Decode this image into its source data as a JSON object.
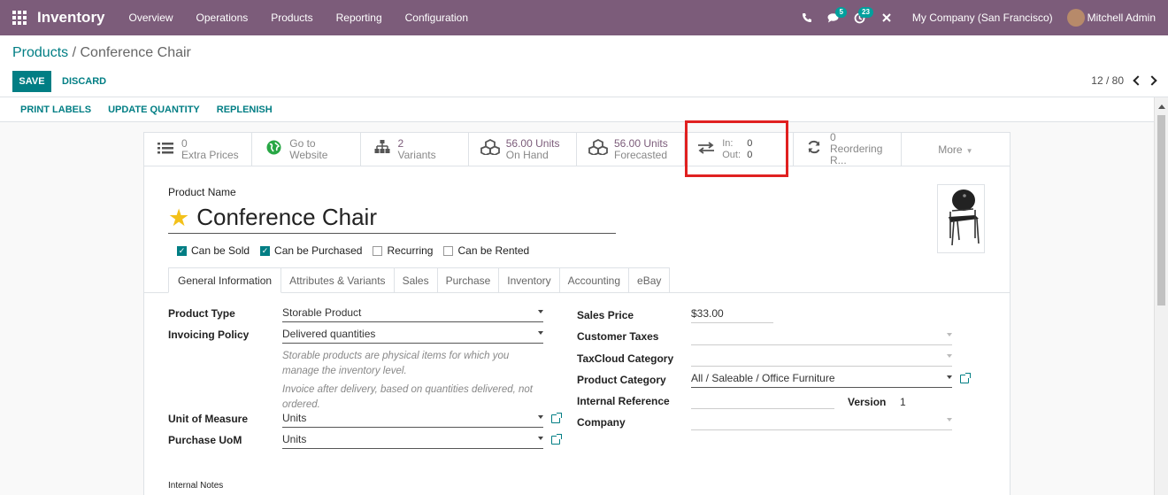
{
  "navbar": {
    "app_title": "Inventory",
    "menu": [
      "Overview",
      "Operations",
      "Products",
      "Reporting",
      "Configuration"
    ],
    "icons": [
      "phone-icon",
      "chat-icon",
      "activity-icon",
      "debug-icon"
    ],
    "chat_badge": "5",
    "activity_badge": "23",
    "company": "My Company (San Francisco)",
    "user": "Mitchell Admin",
    "color": "#7c5c7a"
  },
  "breadcrumb": {
    "parent": "Products",
    "separator": " / ",
    "current": "Conference Chair"
  },
  "buttons": {
    "save": "SAVE",
    "discard": "DISCARD"
  },
  "pager": {
    "value": "12 / 80"
  },
  "actions": [
    "PRINT LABELS",
    "UPDATE QUANTITY",
    "REPLENISH"
  ],
  "smart_buttons": {
    "extra_prices": {
      "value": "0",
      "label": "Extra Prices",
      "icon": "list-icon"
    },
    "website": {
      "value": "Go to",
      "label": "Website",
      "icon": "globe-icon"
    },
    "variants": {
      "value": "2",
      "label": "Variants",
      "icon": "sitemap-icon"
    },
    "on_hand": {
      "value": "56.00 Units",
      "label": "On Hand",
      "icon": "cubes-icon"
    },
    "forecasted": {
      "value": "56.00 Units",
      "label": "Forecasted",
      "icon": "cubes-icon"
    },
    "in_out": {
      "in_label": "In:",
      "in_value": "0",
      "out_label": "Out:",
      "out_value": "0",
      "icon": "exchange-icon"
    },
    "reordering": {
      "value": "0",
      "label": "Reordering R...",
      "icon": "refresh-icon"
    },
    "more": "More"
  },
  "product": {
    "name_label": "Product Name",
    "name": "Conference Chair",
    "checkboxes": [
      {
        "label": "Can be Sold",
        "checked": true
      },
      {
        "label": "Can be Purchased",
        "checked": true
      },
      {
        "label": "Recurring",
        "checked": false
      },
      {
        "label": "Can be Rented",
        "checked": false
      }
    ]
  },
  "tabs": [
    "General Information",
    "Attributes & Variants",
    "Sales",
    "Purchase",
    "Inventory",
    "Accounting",
    "eBay"
  ],
  "left_fields": {
    "product_type_label": "Product Type",
    "product_type": "Storable Product",
    "invoicing_label": "Invoicing Policy",
    "invoicing": "Delivered quantities",
    "help1": "Storable products are physical items for which you manage the inventory level.",
    "help2": "Invoice after delivery, based on quantities delivered, not ordered.",
    "uom_label": "Unit of Measure",
    "uom": "Units",
    "purchase_uom_label": "Purchase UoM",
    "purchase_uom": "Units"
  },
  "right_fields": {
    "sales_price_label": "Sales Price",
    "sales_price": "$33.00",
    "customer_taxes_label": "Customer Taxes",
    "taxcloud_label": "TaxCloud Category",
    "category_label": "Product Category",
    "category": "All / Saleable / Office Furniture",
    "internal_ref_label": "Internal Reference",
    "version_label": "Version",
    "version": "1",
    "company_label": "Company"
  },
  "notes_label": "Internal Notes",
  "colors": {
    "primary": "#017e84",
    "highlight": "#e02020",
    "star": "#f3c11a"
  }
}
